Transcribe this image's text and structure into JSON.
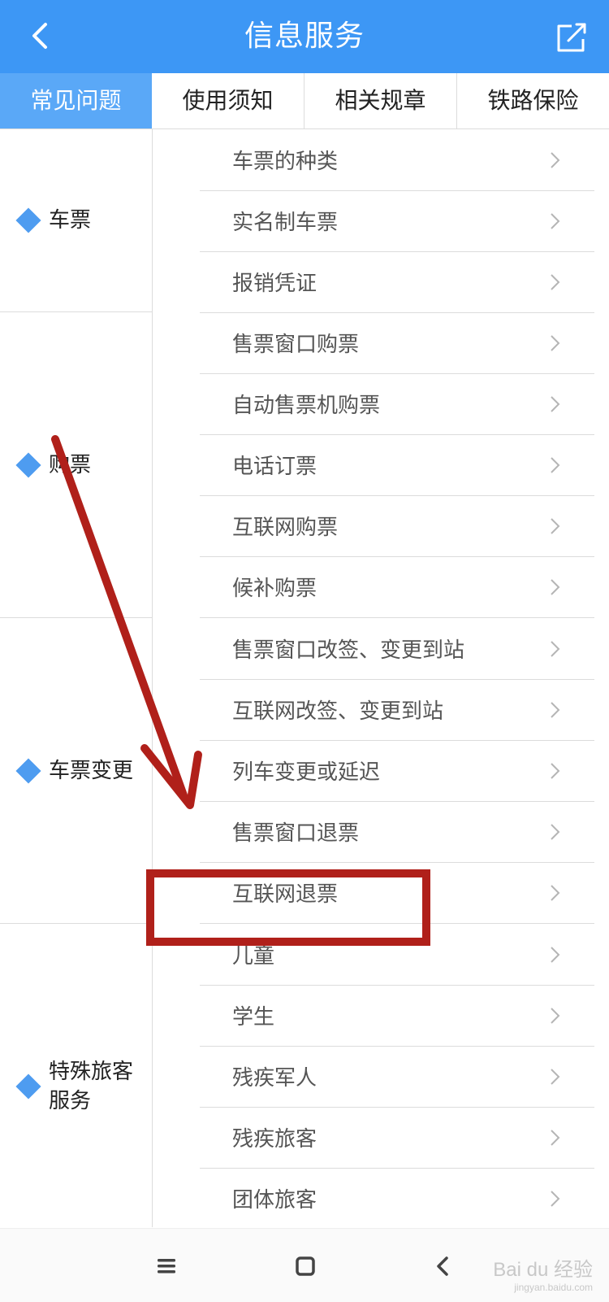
{
  "header": {
    "title": "信息服务",
    "back_icon": "chevron-left-icon",
    "share_icon": "share-icon",
    "background": "#3d97f5"
  },
  "tabs": [
    {
      "label": "常见问题",
      "active": true
    },
    {
      "label": "使用须知",
      "active": false
    },
    {
      "label": "相关规章",
      "active": false
    },
    {
      "label": "铁路保险",
      "active": false
    }
  ],
  "categories": [
    {
      "label": "车票",
      "items": [
        "车票的种类",
        "实名制车票",
        "报销凭证"
      ]
    },
    {
      "label": "购票",
      "items": [
        "售票窗口购票",
        "自动售票机购票",
        "电话订票",
        "互联网购票",
        "候补购票"
      ]
    },
    {
      "label": "车票变更",
      "items": [
        "售票窗口改签、变更到站",
        "互联网改签、变更到站",
        "列车变更或延迟",
        "售票窗口退票",
        "互联网退票"
      ]
    },
    {
      "label": "特殊旅客服务",
      "items": [
        "儿童",
        "学生",
        "残疾军人",
        "残疾旅客",
        "团体旅客"
      ]
    }
  ],
  "annotation": {
    "highlighted_item": "互联网退票",
    "color": "#b0201a"
  },
  "bottom_nav": {
    "menu_icon": "menu-icon",
    "home_icon": "home-icon",
    "back_icon": "back-icon"
  },
  "watermark": {
    "text": "Bai du 经验",
    "sub": "jingyan.baidu.com"
  }
}
